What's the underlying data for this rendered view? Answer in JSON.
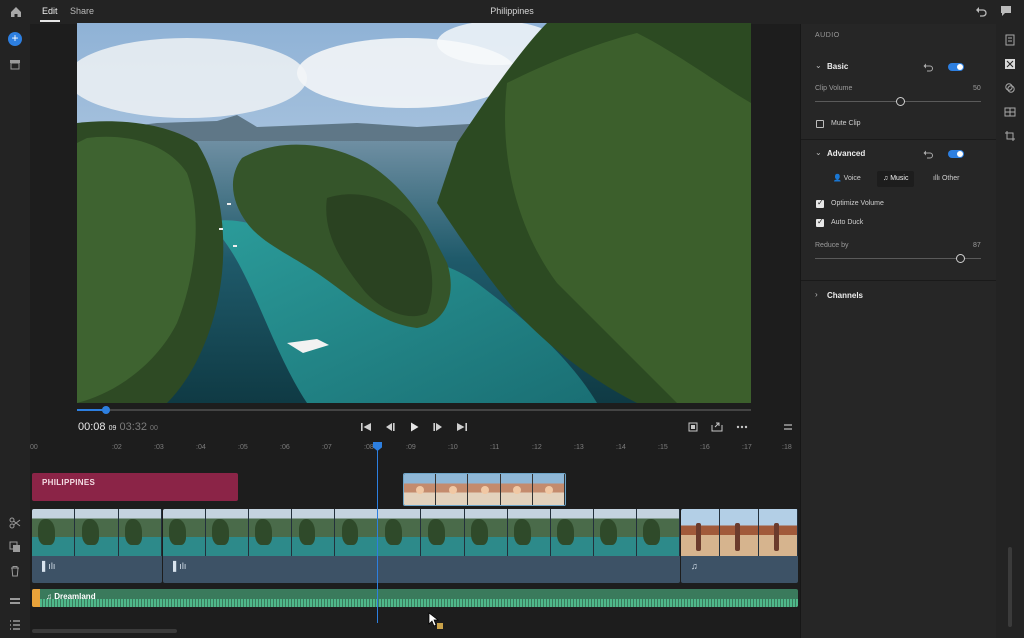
{
  "topbar": {
    "tabs": [
      {
        "label": "Edit",
        "active": true
      },
      {
        "label": "Share",
        "active": false
      }
    ],
    "title": "Philippines",
    "icons": [
      "home-icon",
      "undo-icon",
      "comment-icon"
    ]
  },
  "left_rail": {
    "icons": [
      "add-media-icon",
      "media-bin-icon",
      "scissors-icon",
      "duplicate-icon",
      "trash-icon",
      "track-icon",
      "list-icon"
    ]
  },
  "playback": {
    "current_time": "00:08",
    "current_frames": "09",
    "total_time": "03:32",
    "total_frames": "00",
    "progress_fraction": 0.04,
    "controls": [
      "skip-back-icon",
      "step-back-icon",
      "play-icon",
      "step-forward-icon",
      "skip-forward-icon",
      "fit-icon",
      "export-frame-icon",
      "more-icon"
    ]
  },
  "timeline": {
    "ruler": [
      "00",
      ":02",
      ":03",
      ":04",
      ":05",
      ":06",
      ":07",
      ":08",
      ":09",
      ":10",
      ":11",
      ":12",
      ":13",
      ":14",
      ":15",
      ":16",
      ":17",
      ":18"
    ],
    "playhead_time": ":08.9",
    "title_clip": "PHILIPPINES",
    "audio_clip": "Dreamland",
    "audio_note_icon": "music-note-icon",
    "waveform_icon": "waveform-icon"
  },
  "panel": {
    "header": "AUDIO",
    "basic": {
      "title": "Basic",
      "enabled": true,
      "clip_volume_label": "Clip Volume",
      "clip_volume_value": "50",
      "mute_clip_label": "Mute Clip",
      "mute_clip_checked": false
    },
    "advanced": {
      "title": "Advanced",
      "enabled": true,
      "types": [
        {
          "label": "Voice",
          "icon": "person-icon",
          "selected": false
        },
        {
          "label": "Music",
          "icon": "music-note-icon",
          "selected": true
        },
        {
          "label": "Other",
          "icon": "waveform-icon",
          "selected": false
        }
      ],
      "optimize_volume_label": "Optimize Volume",
      "optimize_volume_checked": true,
      "auto_duck_label": "Auto Duck",
      "auto_duck_checked": true,
      "reduce_by_label": "Reduce by",
      "reduce_by_value": "87"
    },
    "channels": {
      "title": "Channels",
      "expanded": false
    }
  },
  "right_rail": {
    "icons": [
      "adjust-icon",
      "transform-icon",
      "color-icon",
      "aspect-icon",
      "crop-icon"
    ]
  },
  "colors": {
    "accent": "#2d7fe0",
    "title_clip": "#8b2447",
    "audio_clip": "#3a7a5c"
  }
}
